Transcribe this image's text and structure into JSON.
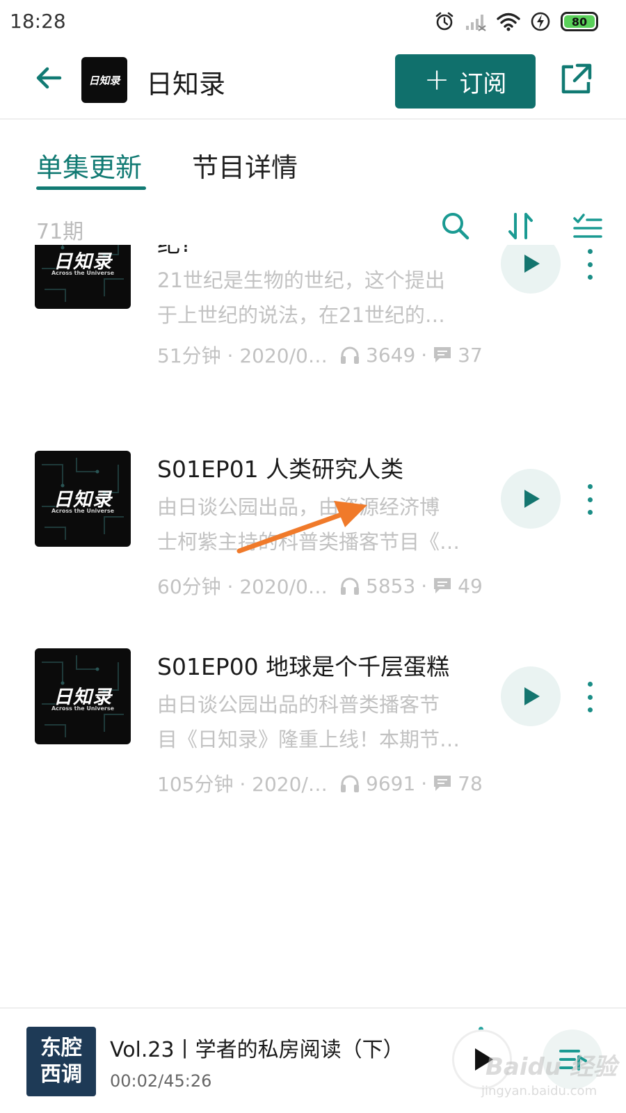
{
  "status_bar": {
    "time": "18:28",
    "battery_level": "80",
    "icons": [
      "alarm-icon",
      "signal-icon",
      "wifi-icon",
      "charging-icon",
      "battery-icon"
    ]
  },
  "header": {
    "title": "日知录",
    "logo_text": "日知录",
    "subscribe_plus": "+",
    "subscribe_label": "订阅"
  },
  "tabs": [
    {
      "label": "单集更新",
      "active": true
    },
    {
      "label": "节目详情",
      "active": false
    }
  ],
  "toolbar": {
    "episode_count": "71期",
    "icons": [
      "search-icon",
      "sort-icon",
      "filter-list-icon"
    ]
  },
  "cover_art": {
    "title": "日知录",
    "subtitle": "Across the Universe"
  },
  "episodes": [
    {
      "title": "纪?",
      "desc_line1": "21世纪是生物的世纪，这个提出",
      "desc_line2": "于上世纪的说法，在21世纪的…",
      "duration_date": "51分钟 · 2020/0…",
      "plays": "3649",
      "comments": "37"
    },
    {
      "title": "S01EP01 人类研究人类",
      "desc_line1": "由日谈公园出品，由资源经济博",
      "desc_line2": "士柯紫主持的科普类播客节目《…",
      "duration_date": "60分钟 · 2020/0…",
      "plays": "5853",
      "comments": "49"
    },
    {
      "title": "S01EP00 地球是个千层蛋糕",
      "desc_line1": "由日谈公园出品的科普类播客节",
      "desc_line2": "目《日知录》隆重上线！本期节…",
      "duration_date": "105分钟 · 2020/…",
      "plays": "9691",
      "comments": "78"
    }
  ],
  "meta_separator": "·",
  "player": {
    "cover_line1": "东腔",
    "cover_line2": "西调",
    "title": "Vol.23丨学者的私房阅读（下）",
    "time": "00:02/45:26"
  },
  "watermark": {
    "main": "Baidu 经验",
    "sub": "jingyan.baidu.com"
  },
  "colors": {
    "accent": "#117a73",
    "subscribe_bg": "#10706c",
    "annotation_arrow": "#f07a2a",
    "muted_text": "#c2c2c2"
  }
}
